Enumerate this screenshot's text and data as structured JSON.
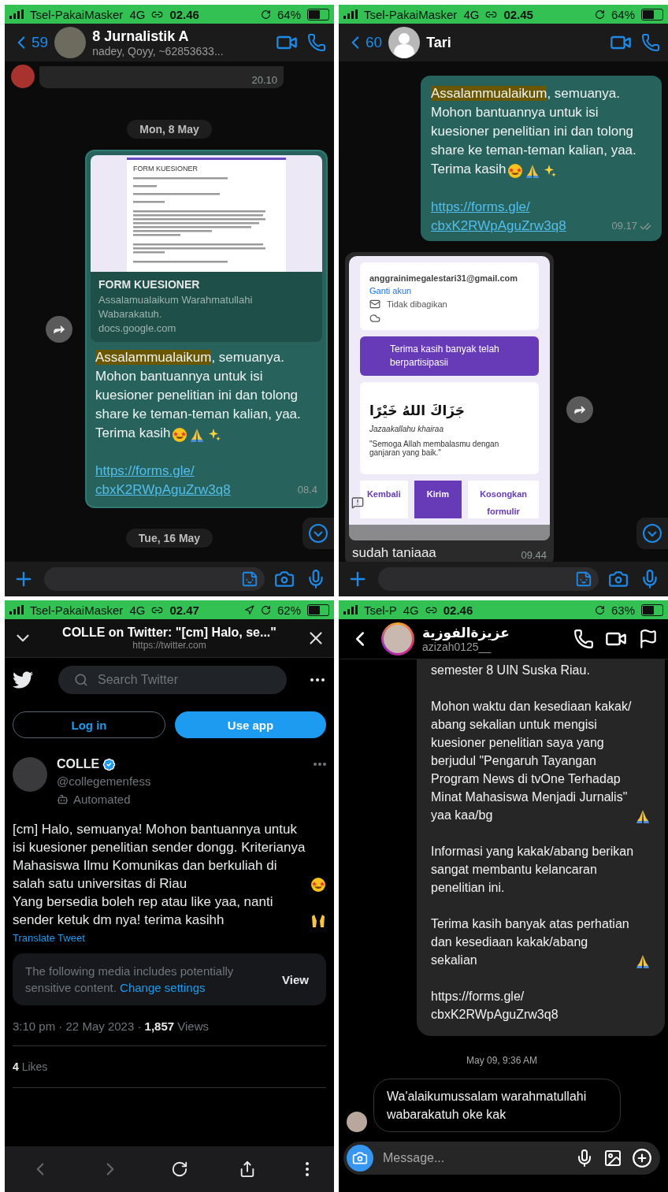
{
  "panels": [
    {
      "kind": "whatsapp",
      "status": {
        "carrier": "Tsel-PakaiMasker",
        "network": "4G",
        "time": "02.46",
        "battery": "64%",
        "location": false
      },
      "header": {
        "back_count": "59",
        "title": "8 Jurnalistik A",
        "subtitle": "nadey, Qoyy, ~62853633..."
      },
      "messages": [
        {
          "kind": "incoming_tail",
          "time": "20.10"
        },
        {
          "kind": "date",
          "label": "Mon, 8 May"
        },
        {
          "kind": "outgoing",
          "forward": true,
          "preview": {
            "doc_title": "FORM KUESIONER",
            "title": "FORM KUESIONER",
            "description": "Assalamualaikum Warahmatullahi Wabarakatuh.",
            "domain": "docs.google.com"
          },
          "highlight": "Assalammualaikum",
          "text": ", semuanya. Mohon bantuannya untuk isi kuesioner penelitian ini dan tolong share ke teman-teman kalian, yaa.",
          "closing": "Terima kasih",
          "link": "https://forms.gle/cbxK2RWpAguZrw3q8",
          "time": "08.4",
          "read": false
        },
        {
          "kind": "date",
          "label": "Tue, 16 May"
        }
      ],
      "scroll_button": true
    },
    {
      "kind": "whatsapp",
      "status": {
        "carrier": "Tsel-PakaiMasker",
        "network": "4G",
        "time": "02.45",
        "battery": "64%",
        "location": false
      },
      "header": {
        "back_count": "60",
        "title": "Tari"
      },
      "messages": [
        {
          "kind": "outgoing",
          "forward": false,
          "highlight": "Assalammualaikum",
          "text": ", semuanya. Mohon bantuannya untuk isi kuesioner penelitian ini dan tolong share ke teman-teman kalian, yaa.",
          "closing": "Terima kasih",
          "link": "https://forms.gle/cbxK2RWpAguZrw3q8",
          "time": "09.17",
          "read": true
        },
        {
          "kind": "incoming_image",
          "forward": true,
          "form": {
            "email": "anggrainimegalestari31@gmail.com",
            "switch_account": "Ganti akun",
            "visibility": "Tidak dibagikan",
            "banner": "Terima kasih banyak telah berpartisipasii",
            "arabic": "جَزَاكَ اللهُ خَيْرًا",
            "transliteration": "Jazaakallahu khairaa",
            "translation": "\"Semoga Allah membalasmu dengan ganjaran yang baik.\"",
            "buttons": [
              {
                "label": "Kembali",
                "primary": false
              },
              {
                "label": "Kirim",
                "primary": true
              },
              {
                "label": "Kosongkan formulir",
                "primary": false
              }
            ]
          },
          "caption": "sudah taniaaa",
          "time": "09.44"
        }
      ],
      "scroll_button": true
    },
    {
      "kind": "twitter",
      "status": {
        "carrier": "Tsel-PakaiMasker",
        "network": "4G",
        "time": "02.47",
        "battery": "62%",
        "location": true
      },
      "header": {
        "title": "COLLE on Twitter: \"[cm] Halo, se...\"",
        "url": "https://twitter.com"
      },
      "search": {
        "placeholder": "Search Twitter"
      },
      "login": "Log in",
      "use_app": "Use app",
      "tweet": {
        "name": "COLLE",
        "verified": true,
        "handle": "@collegemenfess",
        "label": "Automated",
        "segments": [
          "[cm] Halo, semuanya! Mohon bantuannya untuk isi kuesioner penelitian sender dongg. Kriterianya Mahasiswa Ilmu Komunikas dan berkuliah di salah satu universitas di Riau",
          "Yang bersedia boleh rep atau like yaa, nanti sender ketuk dm nya! terima kasihh"
        ],
        "translate": "Translate Tweet",
        "sensitive": {
          "text": "The following media includes potentially sensitive content.",
          "link": "Change settings",
          "action": "View"
        },
        "meta": "3:10 pm · 22 May 2023 · **1,857** Views",
        "likes": "**4** Likes"
      }
    },
    {
      "kind": "instagram",
      "status": {
        "carrier": "Tsel-P",
        "network": "4G",
        "time": "02.46",
        "battery": "63%",
        "location": false
      },
      "header": {
        "name": "عزيزةالفوزية",
        "username": "azizah0125__"
      },
      "paragraphs": [
        "semester 8 UIN Suska Riau.",
        "Mohon waktu dan kesediaan kakak/ abang sekalian untuk mengisi kuesioner penelitian saya yang berjudul \"Pengaruh Tayangan Program News di tvOne Terhadap Minat Mahasiswa Menjadi Jurnalis\" yaa kaa/bg",
        "Informasi yang kakak/abang berikan sangat membantu kelancaran penelitian ini.",
        "Terima kasih banyak atas perhatian dan kesediaan kakak/abang sekalian",
        "https://forms.gle/ cbxK2RWpAguZrw3q8"
      ],
      "timestamp": "May 09, 9:36 AM",
      "reply": "Wa'alaikumussalam warahmatullahi wabarakatuh oke kak",
      "placeholder": "Message..."
    }
  ]
}
